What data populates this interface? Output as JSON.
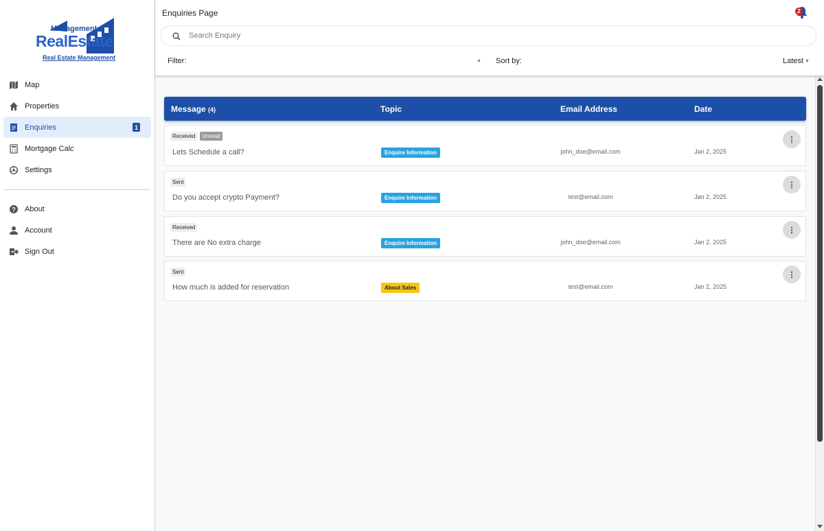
{
  "brand": {
    "logo_top": "Management",
    "logo_main": "RealEstate",
    "logo_sub": "Real Estate Management",
    "primary_color": "#1e4fa8"
  },
  "sidebar": {
    "items": [
      {
        "label": "Map",
        "icon": "map-icon"
      },
      {
        "label": "Properties",
        "icon": "home-icon"
      },
      {
        "label": "Enquiries",
        "icon": "document-icon",
        "badge": "1",
        "active": true
      },
      {
        "label": "Mortgage Calc",
        "icon": "calculator-icon"
      },
      {
        "label": "Settings",
        "icon": "settings-icon"
      }
    ],
    "bottom_items": [
      {
        "label": "About",
        "icon": "help-icon"
      },
      {
        "label": "Account",
        "icon": "person-icon"
      },
      {
        "label": "Sign Out",
        "icon": "sign-out-icon"
      }
    ]
  },
  "header": {
    "title": "Enquiries Page",
    "notification_count": "2",
    "search_placeholder": "Search Enquiry",
    "filter_label": "Filter:",
    "sort_label": "Sort by:",
    "sort_value": "Latest"
  },
  "table": {
    "columns": {
      "message": "Message",
      "message_count": "(4)",
      "topic": "Topic",
      "email": "Email Address",
      "date": "Date"
    },
    "rows": [
      {
        "tags": [
          "Received",
          "Unread"
        ],
        "message": "Lets Schedule a call?",
        "topic": "Enquire Information",
        "topic_color": "#29a3e0",
        "email": "john_doe@email.com",
        "date": "Jan 2, 2025"
      },
      {
        "tags": [
          "Sent"
        ],
        "message": "Do you accept crypto Payment?",
        "topic": "Enquire Information",
        "topic_color": "#29a3e0",
        "email": "test@email.com",
        "date": "Jan 2, 2025"
      },
      {
        "tags": [
          "Received"
        ],
        "message": "There are No extra charge",
        "topic": "Enquire Information",
        "topic_color": "#29a3e0",
        "email": "john_doe@email.com",
        "date": "Jan 2, 2025"
      },
      {
        "tags": [
          "Sent"
        ],
        "message": "How much is added for reservation",
        "topic": "About Sales",
        "topic_color": "#f5c518",
        "email": "test@email.com",
        "date": "Jan 2, 2025"
      }
    ]
  }
}
